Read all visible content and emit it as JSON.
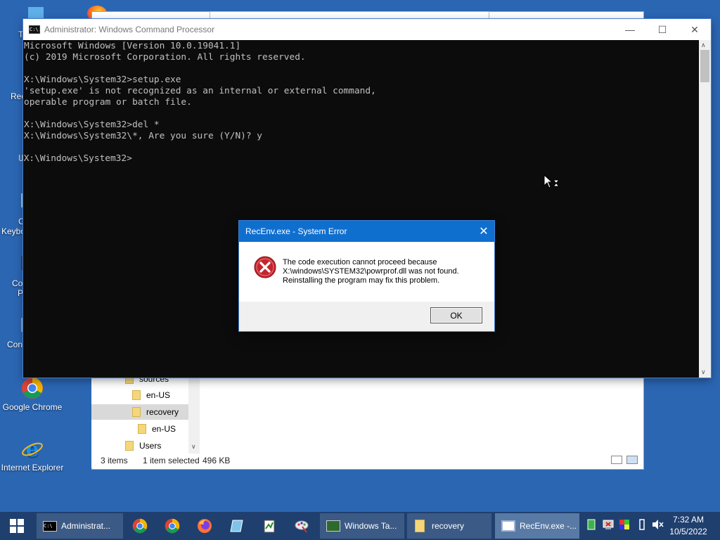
{
  "desktop": {
    "icons": [
      {
        "name": "Google Chrome",
        "icon": "chrome-icon"
      },
      {
        "name": "Internet Explorer",
        "icon": "ie-icon"
      }
    ],
    "partial_labels": [
      "T",
      "Rec",
      "C",
      "Keybo",
      "Co",
      "P",
      "Cont"
    ]
  },
  "explorer": {
    "tree": [
      {
        "label": "sources",
        "level": 1,
        "selected": false
      },
      {
        "label": "en-US",
        "level": 2,
        "selected": false
      },
      {
        "label": "recovery",
        "level": 2,
        "selected": true
      },
      {
        "label": "en-US",
        "level": 3,
        "selected": false
      },
      {
        "label": "Users",
        "level": 1,
        "selected": false
      }
    ],
    "status": {
      "items": "3 items",
      "selected": "1 item selected",
      "size": "496 KB"
    }
  },
  "cmd": {
    "title": "Administrator: Windows Command Processor",
    "lines": [
      "Microsoft Windows [Version 10.0.19041.1]",
      "(c) 2019 Microsoft Corporation. All rights reserved.",
      "",
      "X:\\Windows\\System32>setup.exe",
      "'setup.exe' is not recognized as an internal or external command,",
      "operable program or batch file.",
      "",
      "X:\\Windows\\System32>del *",
      "X:\\Windows\\System32\\*, Are you sure (Y/N)? y",
      "",
      "UX:\\Windows\\System32>"
    ]
  },
  "dialog": {
    "title": "RecEnv.exe - System Error",
    "message_line1": "The code execution cannot proceed because",
    "message_line2": "X:\\windows\\SYSTEM32\\powrprof.dll was not found.",
    "message_line3": "Reinstalling the program may fix this problem.",
    "ok_label": "OK"
  },
  "taskbar": {
    "items": [
      {
        "label": "Administrat...",
        "icon": "cmd-icon"
      },
      {
        "label": "Windows Ta...",
        "icon": "task-manager-icon"
      },
      {
        "label": "recovery",
        "icon": "folder-icon"
      },
      {
        "label": "RecEnv.exe -...",
        "icon": "app-window-icon"
      }
    ],
    "pinned_icons": [
      "chrome-icon",
      "chrome-icon",
      "firefox-icon",
      "notepad-icon",
      "edit-icon",
      "paint-icon"
    ],
    "clock": {
      "time": "7:32 AM",
      "date": "10/5/2022"
    }
  },
  "colors": {
    "desktop_bg": "#2b66b3",
    "taskbar_bg": "#1f3f6f",
    "dialog_title": "#0f6fcf",
    "error_red": "#c4262e"
  }
}
